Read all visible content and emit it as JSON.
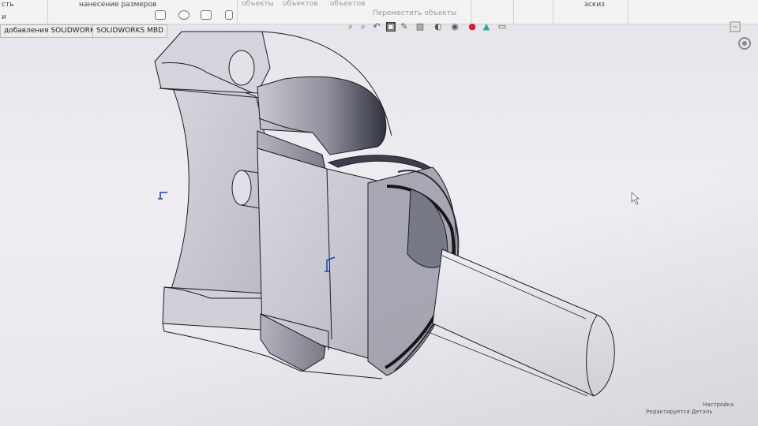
{
  "ribbon": {
    "partial_left_label": "сть",
    "partial_left_label2": "и",
    "dimension_label": "нанесение размеров",
    "faded_labels": [
      "объекты",
      "объектов",
      "объектов",
      "Переместить объекты"
    ],
    "right_tab": "эскиз"
  },
  "doc_tabs": [
    {
      "label": "добавления SOLIDWORKS"
    },
    {
      "label": "SOLIDWORKS MBD"
    }
  ],
  "heads_up_icons": [
    "zoom-to-fit-icon",
    "zoom-area-icon",
    "previous-view-icon",
    "section-view-icon",
    "dynamic-annotation-icon",
    "view-orientation-icon",
    "display-style-icon",
    "hide-show-icon",
    "edit-appearance-icon",
    "scene-icon",
    "view-settings-icon"
  ],
  "status_bar": {
    "edit_label": "Редактируется Деталь",
    "units_label": "Настройка"
  },
  "colors": {
    "part_shade": "#c9c9d3",
    "part_dark": "#3a3d48",
    "edge": "#1b1b22",
    "origin_blue": "#1a3bd0",
    "background": "#ebe9ef"
  }
}
